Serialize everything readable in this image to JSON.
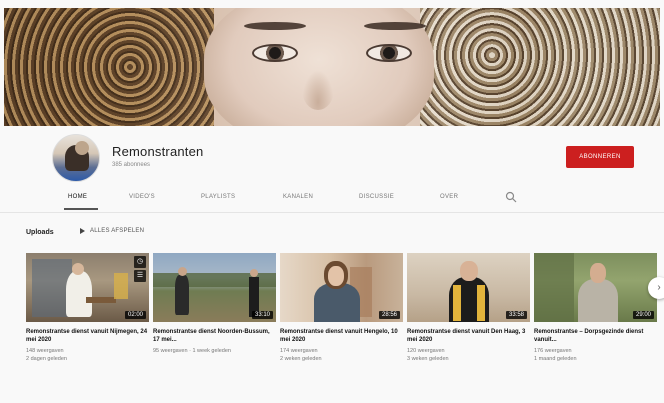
{
  "channel": {
    "name": "Remonstranten",
    "subscribers": "385 abonnees",
    "subscribe_label": "ABONNEREN"
  },
  "tabs": [
    {
      "label": "HOME"
    },
    {
      "label": "VIDEO'S"
    },
    {
      "label": "PLAYLISTS"
    },
    {
      "label": "KANALEN"
    },
    {
      "label": "DISCUSSIE"
    },
    {
      "label": "OVER"
    }
  ],
  "uploads": {
    "title": "Uploads",
    "play_all_label": "ALLES AFSPELEN"
  },
  "videos": [
    {
      "title": "Remonstrantse dienst vanuit Nijmegen, 24 mei 2020",
      "views": "148 weergaven",
      "age": "2 dagen geleden",
      "duration": "02:00"
    },
    {
      "title": "Remonstrantse dienst Noorden-Bussum, 17 mei...",
      "views": "95 weergaven",
      "age": "1 week geleden",
      "duration": "33:10"
    },
    {
      "title": "Remonstrantse dienst vanuit Hengelo, 10 mei 2020",
      "views": "174 weergaven",
      "age": "2 weken geleden",
      "duration": "28:56"
    },
    {
      "title": "Remonstrantse dienst vanuit Den Haag, 3 mei 2020",
      "views": "120 weergaven",
      "age": "3 weken geleden",
      "duration": "33:58"
    },
    {
      "title": "Remonstrantse – Dorpsgezinde dienst vanuit...",
      "views": "176 weergaven",
      "age": "1 maand geleden",
      "duration": "29:00"
    }
  ],
  "colors": {
    "subscribe": "#cc1f1f",
    "background": "#f9f9f9"
  }
}
